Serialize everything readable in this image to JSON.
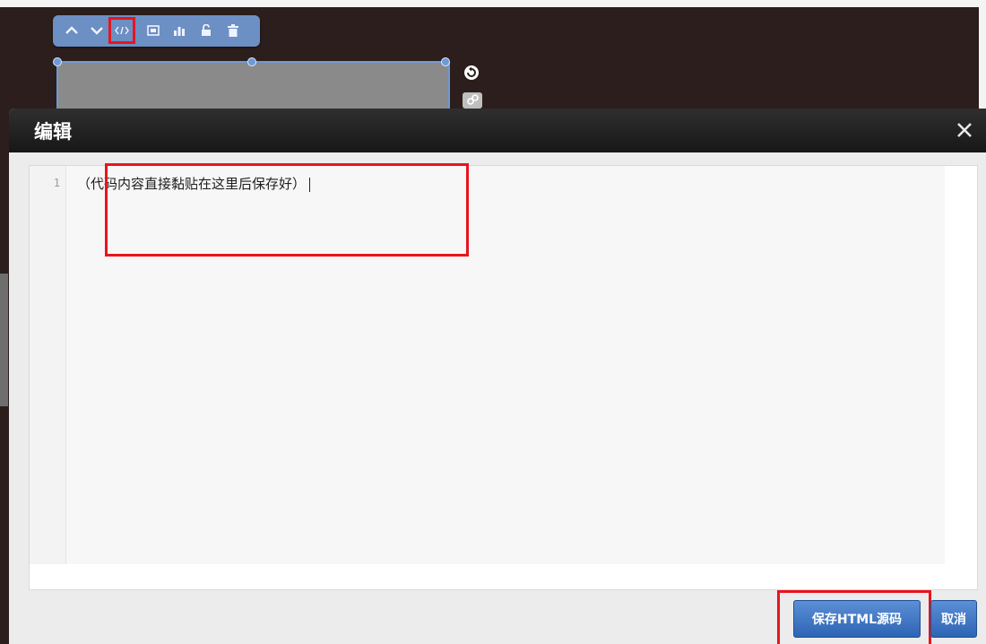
{
  "toolbar": {
    "icons": [
      "move-up-icon",
      "move-down-icon",
      "code-view-icon",
      "screen-icon",
      "chart-icon",
      "unlock-icon",
      "trash-icon"
    ],
    "highlight_color": "#e8141d",
    "bg_color": "#6c8fc4"
  },
  "canvas": {
    "side_icons": [
      "refresh-icon",
      "link-icon"
    ]
  },
  "dialog": {
    "title": "编辑",
    "editor": {
      "line_number": "1",
      "line_text": "（代码内容直接黏贴在这里后保存好）"
    },
    "buttons": {
      "save_html": "保存HTML源码",
      "cancel": "取消"
    }
  }
}
